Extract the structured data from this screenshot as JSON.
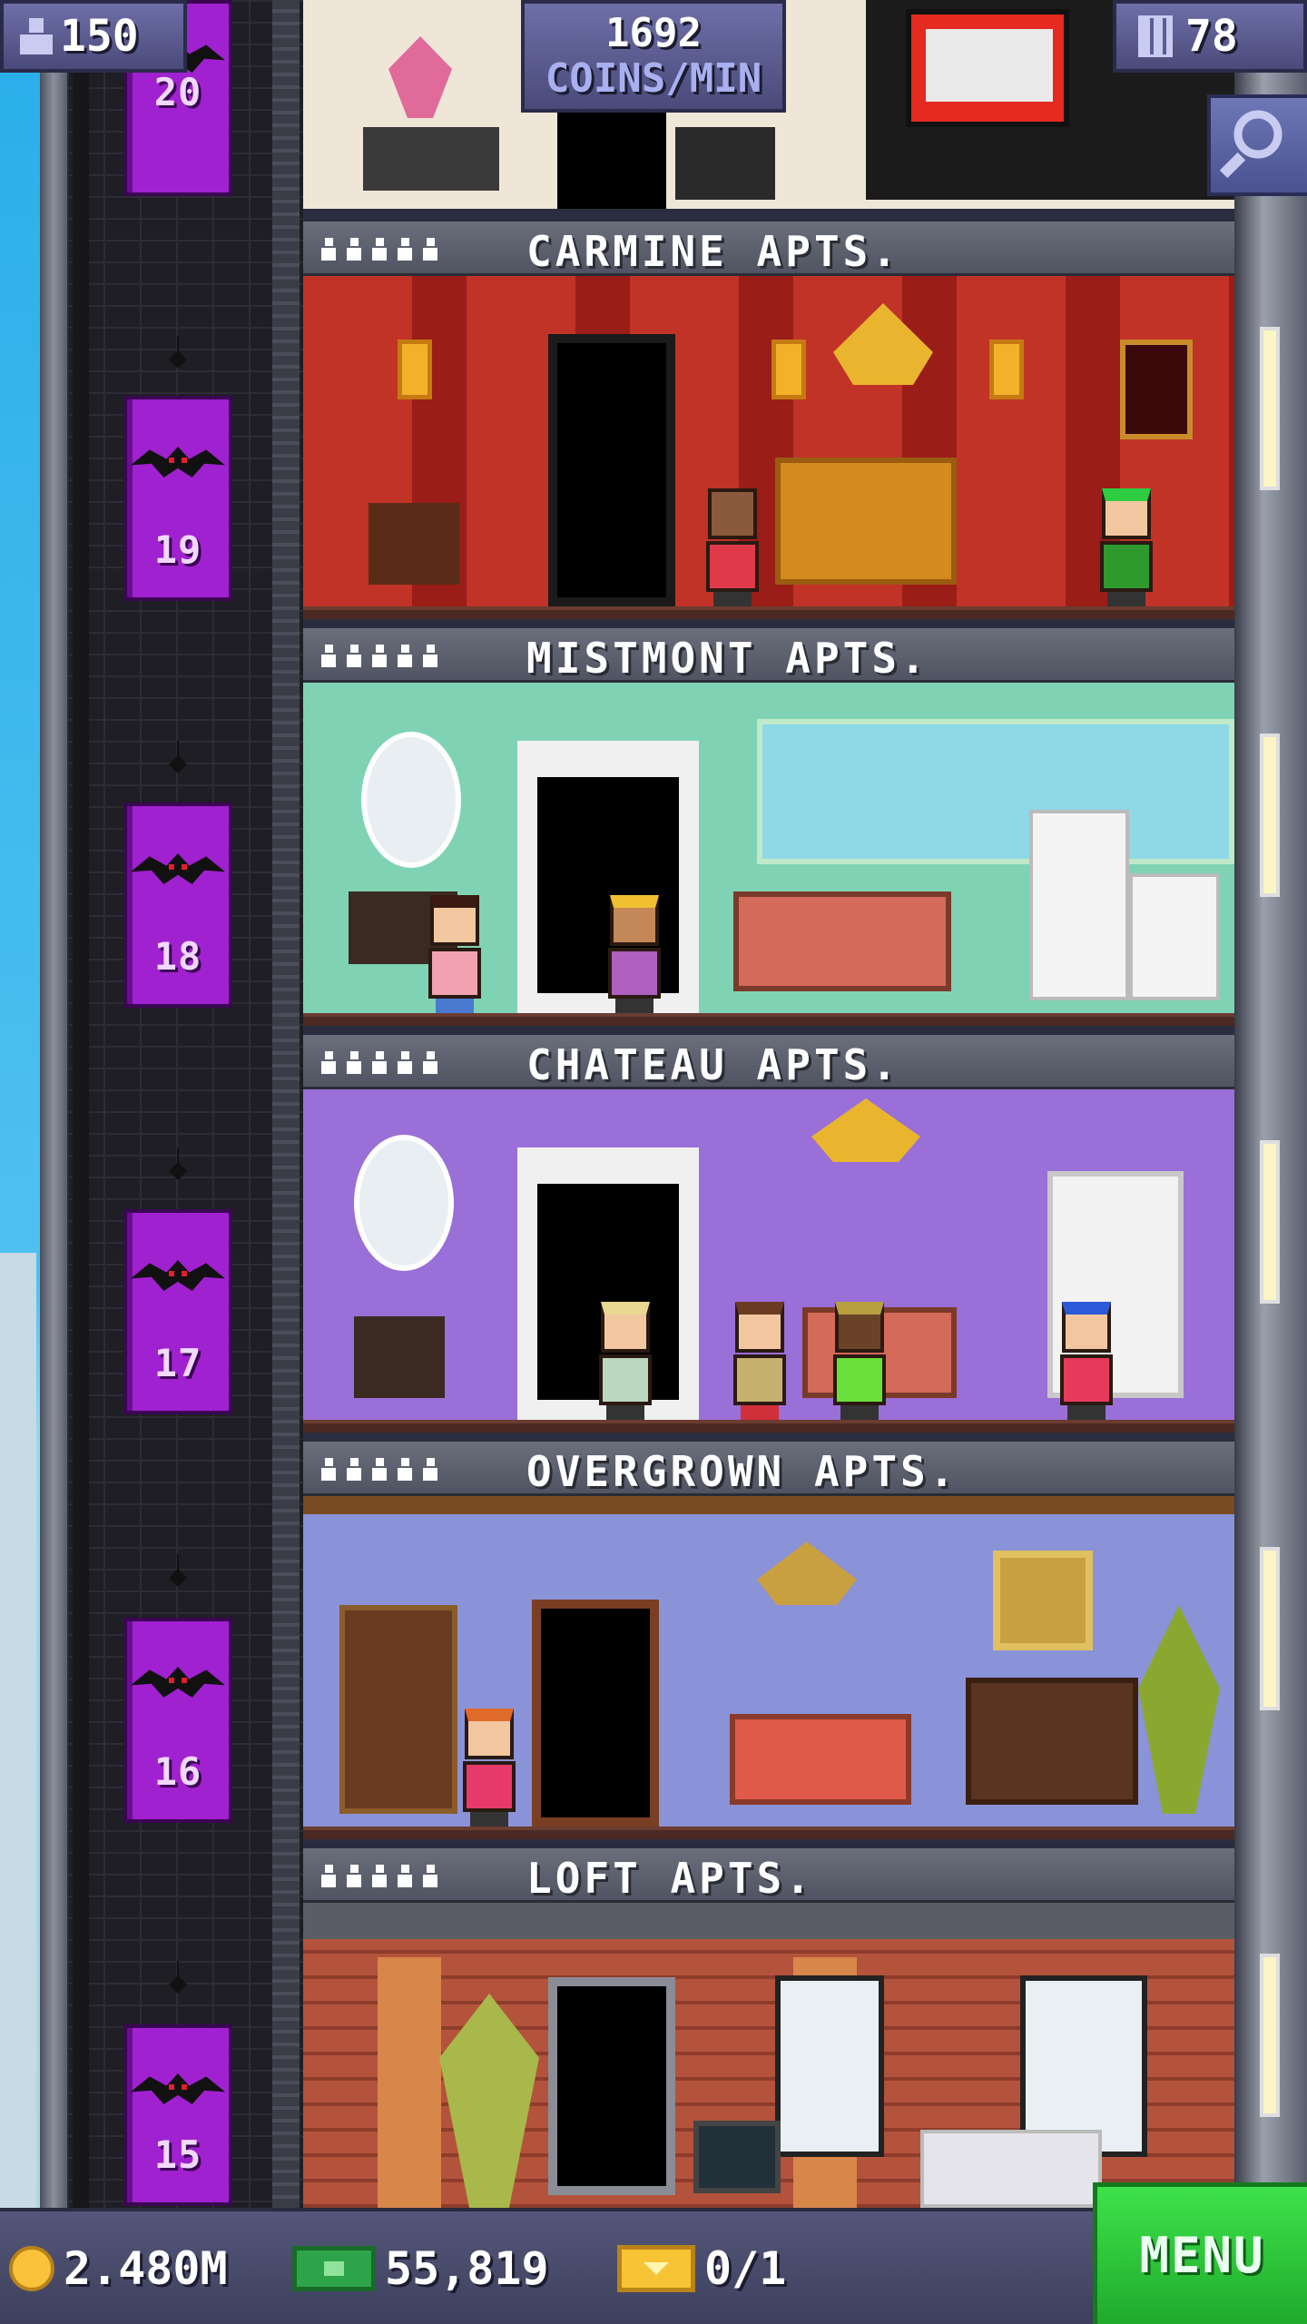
{
  "hud": {
    "population": "150",
    "coins_per_min_value": "1692",
    "coins_per_min_unit": "COINS/MIN",
    "floor_count": "78"
  },
  "elevator": {
    "cars": [
      {
        "floor": "20"
      },
      {
        "floor": "19"
      },
      {
        "floor": "18"
      },
      {
        "floor": "17"
      },
      {
        "floor": "16"
      },
      {
        "floor": "15"
      }
    ]
  },
  "floors": [
    {
      "name": "CARMINE APTS.",
      "theme": "carmine",
      "residents": 5
    },
    {
      "name": "MISTMONT APTS.",
      "theme": "mistmont",
      "residents": 5
    },
    {
      "name": "CHATEAU APTS.",
      "theme": "chateau",
      "residents": 5
    },
    {
      "name": "OVERGROWN APTS.",
      "theme": "overgrown",
      "residents": 5
    },
    {
      "name": "LOFT APTS.",
      "theme": "loft",
      "residents": 5
    }
  ],
  "bottom_bar": {
    "coins": "2.480M",
    "bux": "55,819",
    "tickets": "0/1",
    "menu_label": "MENU"
  },
  "icons": {
    "population": "person-icon",
    "floors": "building-icon",
    "search": "magnifier-icon",
    "coins": "coin-icon",
    "bux": "bux-icon",
    "tickets": "ticket-icon"
  },
  "colors": {
    "elevator": "#a021cf",
    "menu": "#2fc83c",
    "hud": "#5a5b90"
  }
}
